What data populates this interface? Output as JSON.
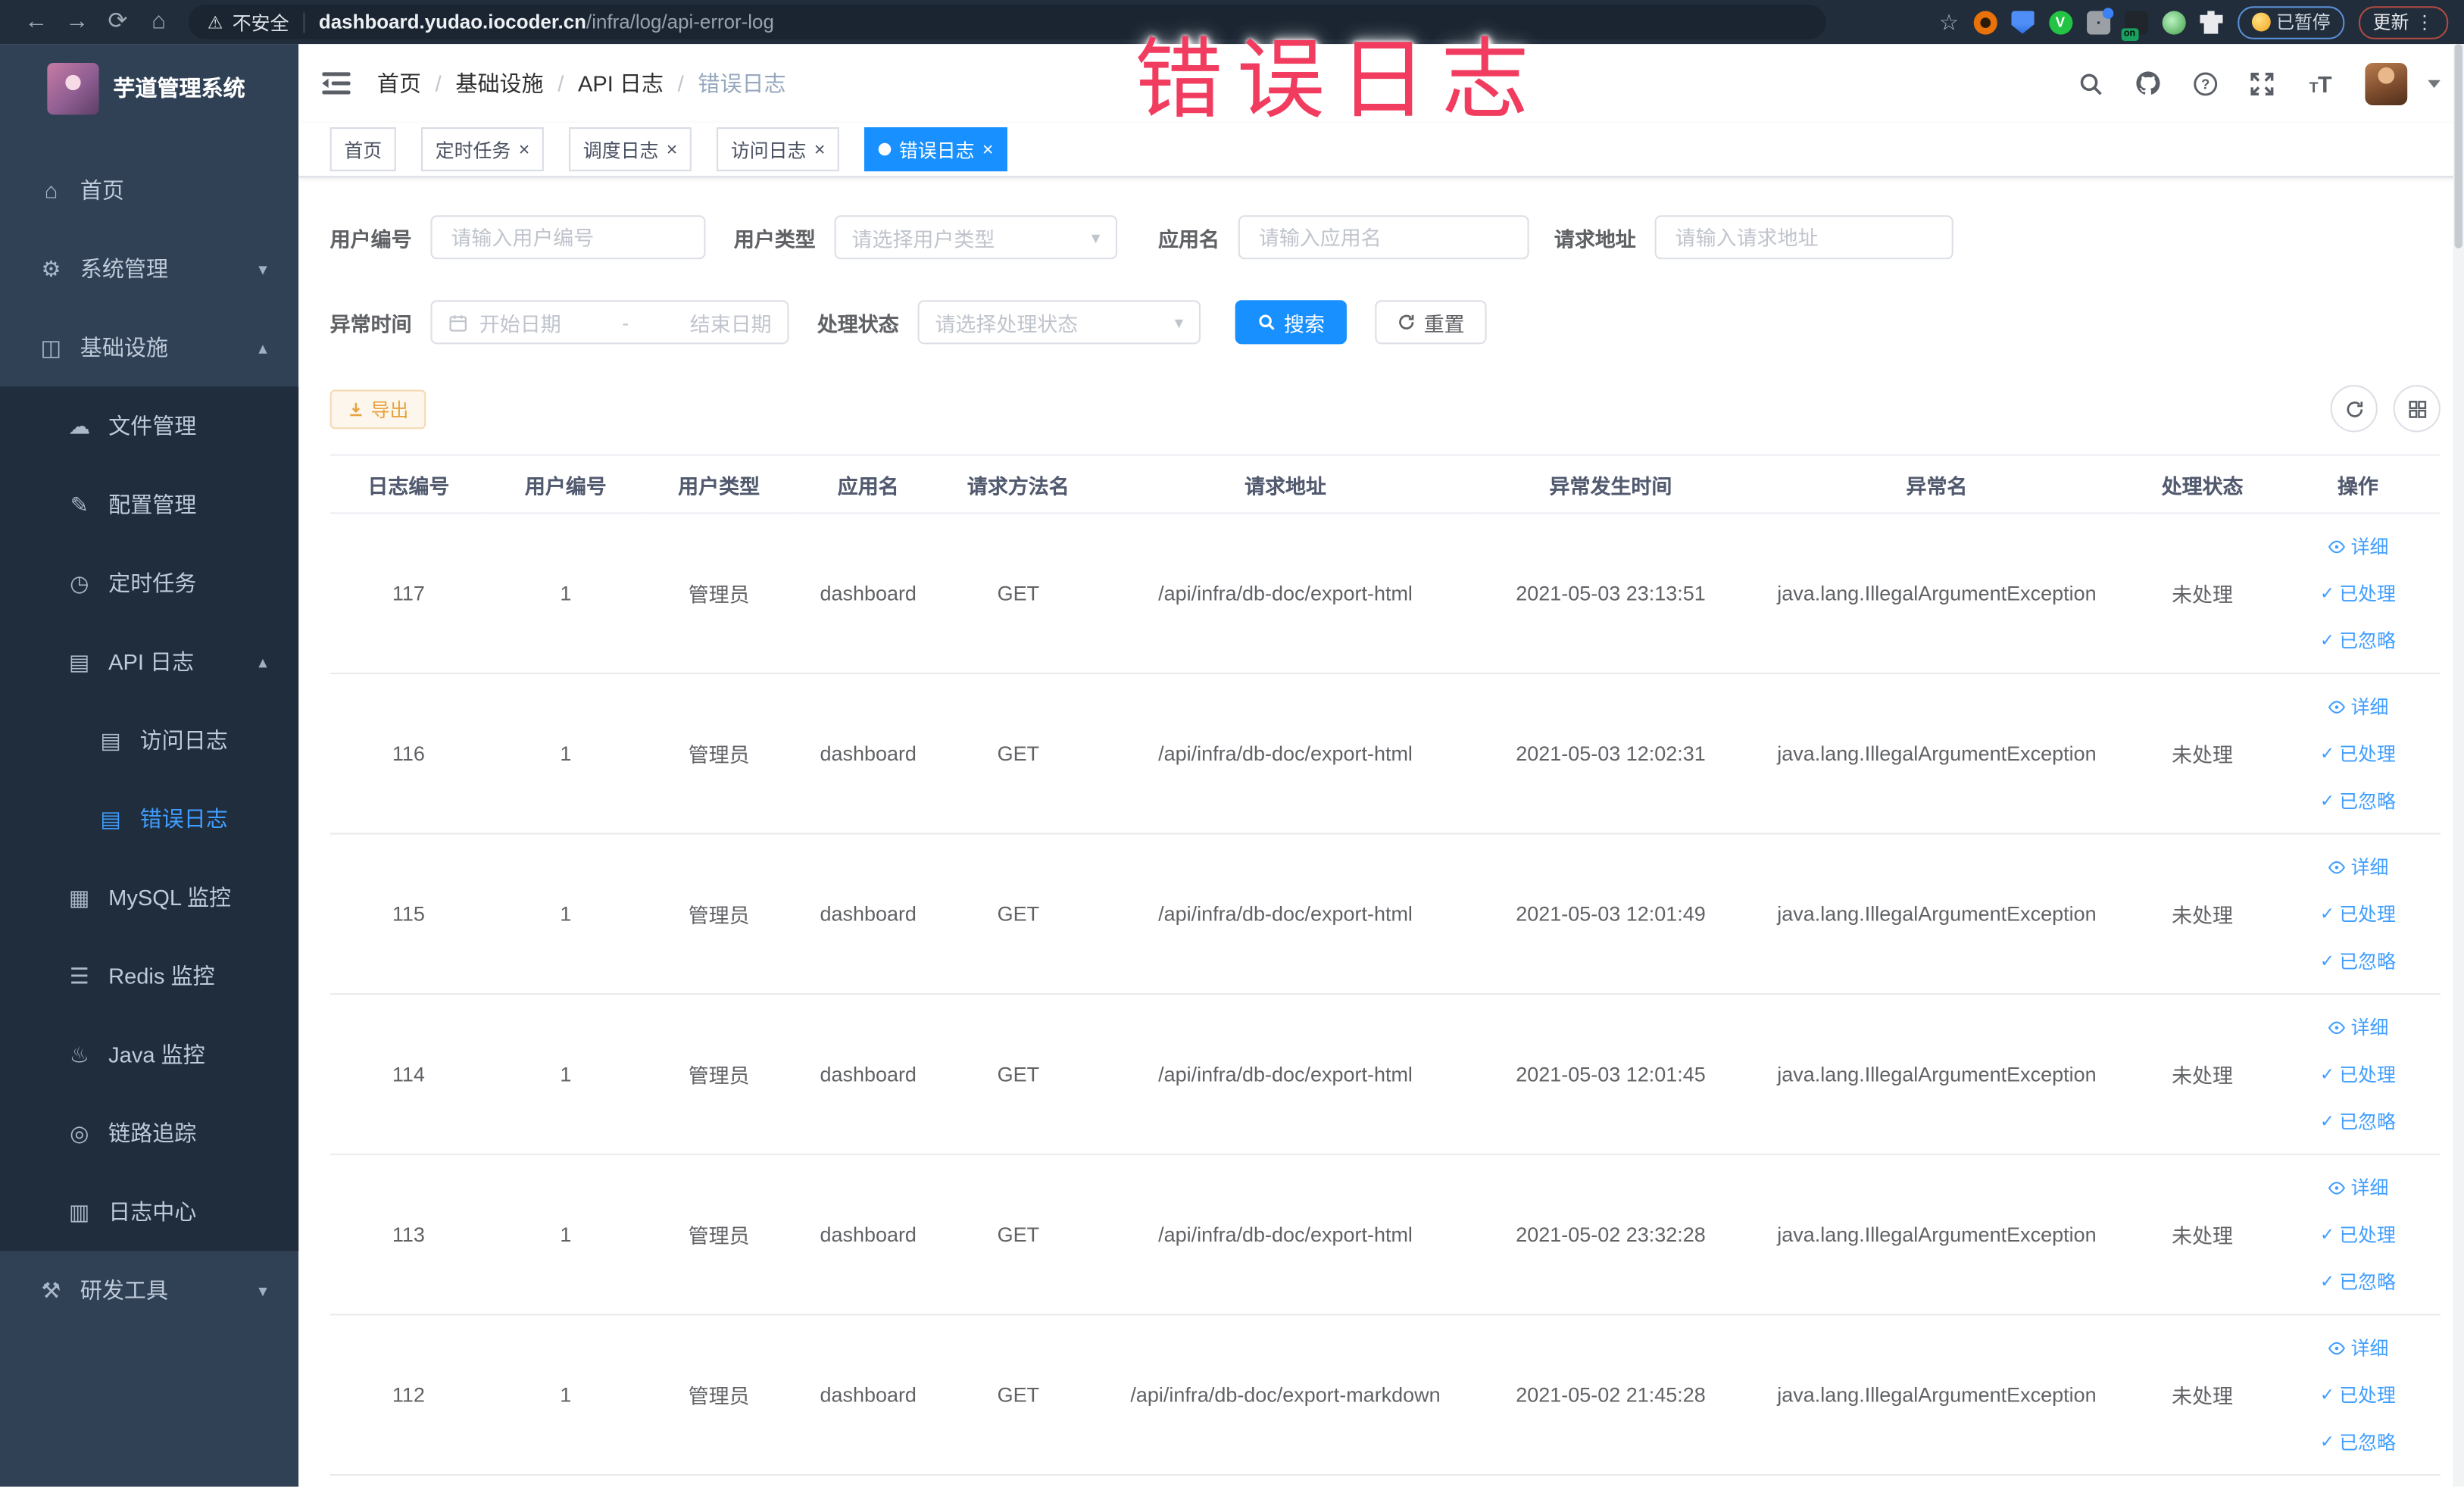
{
  "browser": {
    "insecure_label": "不安全",
    "url_host": "dashboard.yudao.iocoder.cn",
    "url_path": "/infra/log/api-error-log",
    "extension_on_badge": "on",
    "paused_badge": "已暂停",
    "update_badge": "更新"
  },
  "annotation": {
    "text": "错误日志",
    "color": "#f23c5f"
  },
  "sidebar": {
    "title": "芋道管理系统",
    "items": [
      {
        "label": "首页",
        "icon": "home-icon",
        "glyph": "⌂",
        "level": 1
      },
      {
        "label": "系统管理",
        "icon": "gear-icon",
        "glyph": "⚙",
        "level": 1,
        "arrow": "down"
      },
      {
        "label": "基础设施",
        "icon": "infrastructure-icon",
        "glyph": "◫",
        "level": 1,
        "arrow": "up"
      },
      {
        "label": "文件管理",
        "icon": "file-upload-icon",
        "glyph": "☁",
        "level": 2
      },
      {
        "label": "配置管理",
        "icon": "config-edit-icon",
        "glyph": "✎",
        "level": 2
      },
      {
        "label": "定时任务",
        "icon": "timer-icon",
        "glyph": "◷",
        "level": 2
      },
      {
        "label": "API 日志",
        "icon": "api-log-icon",
        "glyph": "▤",
        "level": 2,
        "arrow": "up"
      },
      {
        "label": "访问日志",
        "icon": "access-log-icon",
        "glyph": "▤",
        "level": 3
      },
      {
        "label": "错误日志",
        "icon": "error-log-icon",
        "glyph": "▤",
        "level": 3,
        "active": true
      },
      {
        "label": "MySQL 监控",
        "icon": "mysql-monitor-icon",
        "glyph": "▦",
        "level": 2
      },
      {
        "label": "Redis 监控",
        "icon": "redis-monitor-icon",
        "glyph": "☰",
        "level": 2
      },
      {
        "label": "Java 监控",
        "icon": "java-monitor-icon",
        "glyph": "♨",
        "level": 2
      },
      {
        "label": "链路追踪",
        "icon": "trace-icon",
        "glyph": "◎",
        "level": 2
      },
      {
        "label": "日志中心",
        "icon": "log-center-icon",
        "glyph": "▥",
        "level": 2
      },
      {
        "label": "研发工具",
        "icon": "devtools-icon",
        "glyph": "⚒",
        "level": 1,
        "arrow": "down"
      }
    ]
  },
  "breadcrumb": {
    "items": [
      "首页",
      "基础设施",
      "API 日志"
    ],
    "current": "错误日志"
  },
  "tabs": [
    {
      "label": "首页",
      "closable": false,
      "active": false
    },
    {
      "label": "定时任务",
      "closable": true,
      "active": false
    },
    {
      "label": "调度日志",
      "closable": true,
      "active": false
    },
    {
      "label": "访问日志",
      "closable": true,
      "active": false
    },
    {
      "label": "错误日志",
      "closable": true,
      "active": true
    }
  ],
  "filters": {
    "user_id_label": "用户编号",
    "user_id_placeholder": "请输入用户编号",
    "user_type_label": "用户类型",
    "user_type_placeholder": "请选择用户类型",
    "app_name_label": "应用名",
    "app_name_placeholder": "请输入应用名",
    "request_url_label": "请求地址",
    "request_url_placeholder": "请输入请求地址",
    "time_label": "异常时间",
    "time_start_placeholder": "开始日期",
    "time_separator": "-",
    "time_end_placeholder": "结束日期",
    "status_label": "处理状态",
    "status_placeholder": "请选择处理状态",
    "search_label": "搜索",
    "reset_label": "重置"
  },
  "toolbar": {
    "export_label": "导出"
  },
  "table": {
    "columns": [
      "日志编号",
      "用户编号",
      "用户类型",
      "应用名",
      "请求方法名",
      "请求地址",
      "异常发生时间",
      "异常名",
      "处理状态",
      "操作"
    ],
    "actions": [
      {
        "label": "详细",
        "icon": "eye"
      },
      {
        "label": "已处理",
        "icon": "check"
      },
      {
        "label": "已忽略",
        "icon": "check"
      }
    ],
    "rows": [
      {
        "id": "117",
        "user_id": "1",
        "user_type": "管理员",
        "app": "dashboard",
        "method": "GET",
        "url": "/api/infra/db-doc/export-html",
        "time": "2021-05-03 23:13:51",
        "exception": "java.lang.IllegalArgumentException",
        "status": "未处理"
      },
      {
        "id": "116",
        "user_id": "1",
        "user_type": "管理员",
        "app": "dashboard",
        "method": "GET",
        "url": "/api/infra/db-doc/export-html",
        "time": "2021-05-03 12:02:31",
        "exception": "java.lang.IllegalArgumentException",
        "status": "未处理"
      },
      {
        "id": "115",
        "user_id": "1",
        "user_type": "管理员",
        "app": "dashboard",
        "method": "GET",
        "url": "/api/infra/db-doc/export-html",
        "time": "2021-05-03 12:01:49",
        "exception": "java.lang.IllegalArgumentException",
        "status": "未处理"
      },
      {
        "id": "114",
        "user_id": "1",
        "user_type": "管理员",
        "app": "dashboard",
        "method": "GET",
        "url": "/api/infra/db-doc/export-html",
        "time": "2021-05-03 12:01:45",
        "exception": "java.lang.IllegalArgumentException",
        "status": "未处理"
      },
      {
        "id": "113",
        "user_id": "1",
        "user_type": "管理员",
        "app": "dashboard",
        "method": "GET",
        "url": "/api/infra/db-doc/export-html",
        "time": "2021-05-02 23:32:28",
        "exception": "java.lang.IllegalArgumentException",
        "status": "未处理"
      },
      {
        "id": "112",
        "user_id": "1",
        "user_type": "管理员",
        "app": "dashboard",
        "method": "GET",
        "url": "/api/infra/db-doc/export-markdown",
        "time": "2021-05-02 21:45:28",
        "exception": "java.lang.IllegalArgumentException",
        "status": "未处理"
      }
    ]
  }
}
